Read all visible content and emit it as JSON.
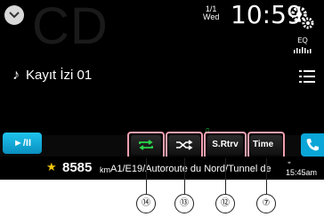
{
  "background_label": "CD",
  "date": {
    "day": "1/1",
    "weekday": "Wed"
  },
  "clock": "10:59",
  "eq_label": "EQ",
  "track": {
    "title": "Kayıt İzi 01"
  },
  "controls": {
    "play_pause": "►/II",
    "srtrv": "S.Rtrv",
    "time": "Time"
  },
  "nav": {
    "distance": "8585",
    "unit": "km",
    "road": "A1/E19/Autoroute du Nord/Tunnel de",
    "time": "15:45am"
  },
  "callouts": {
    "c14": "⑭",
    "c13": "⑬",
    "c12": "⑫",
    "c7": "⑦"
  },
  "colors": {
    "accent": "#0aa6d8",
    "star": "#f3c70e",
    "callout_border": "#f2a0b0",
    "note_icon": "#1ec43c"
  }
}
